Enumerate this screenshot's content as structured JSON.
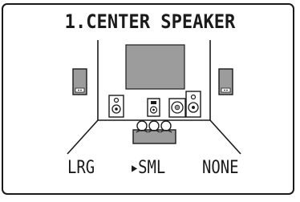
{
  "menu": {
    "title": "1.CENTER SPEAKER"
  },
  "options": {
    "large": "LRG",
    "small": "SML",
    "none": "NONE",
    "selected": "small",
    "cursor": "▶"
  },
  "colors": {
    "ink": "#1a1a1a",
    "screen": "#9c9c9c",
    "background": "#ffffff"
  }
}
